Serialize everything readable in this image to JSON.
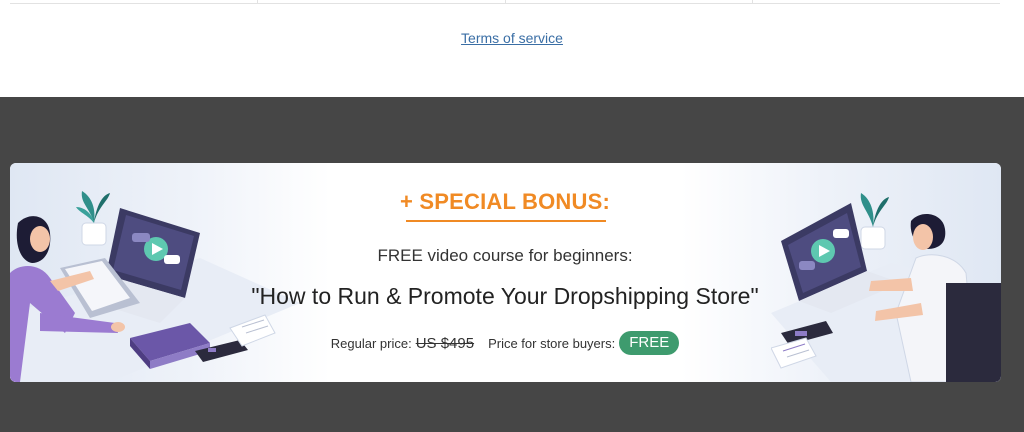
{
  "footer": {
    "terms_link": "Terms of service"
  },
  "bonus": {
    "title": "+ SPECIAL BONUS:",
    "subtitle": "FREE video course for beginners:",
    "course_title": "\"How to Run & Promote Your Dropshipping Store\"",
    "regular_price_label": "Regular price:",
    "regular_price": "US $495",
    "store_price_label": "Price for store buyers:",
    "store_price": "FREE"
  },
  "colors": {
    "accent_orange": "#f08a24",
    "badge_green": "#3e9b6e",
    "dark_band": "#464646",
    "link_blue": "#3a6ea5"
  }
}
